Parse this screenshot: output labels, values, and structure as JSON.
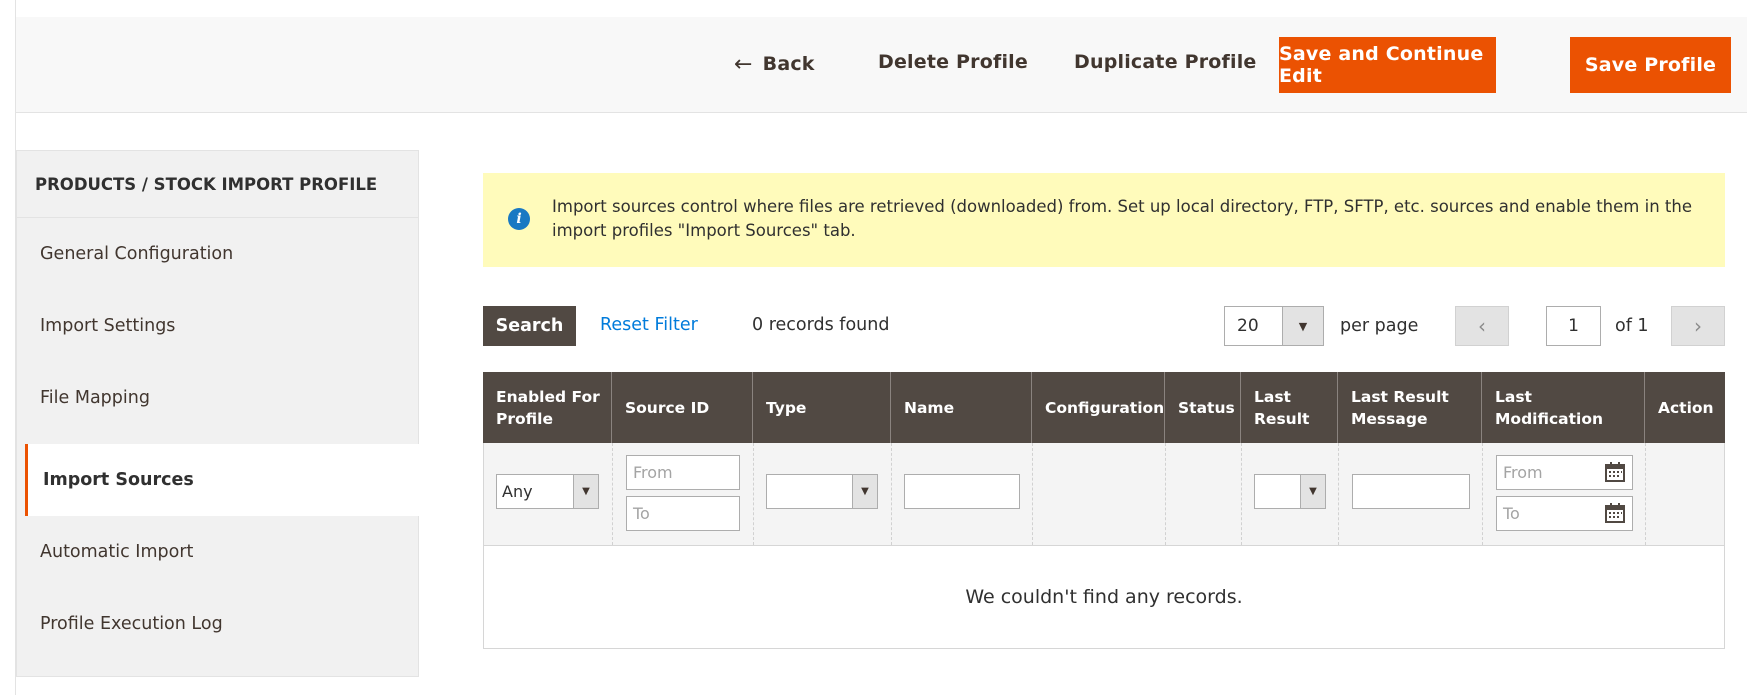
{
  "toolbar": {
    "back_label": "Back",
    "delete_label": "Delete Profile",
    "duplicate_label": "Duplicate Profile",
    "save_continue_label": "Save and Continue Edit",
    "save_label": "Save Profile"
  },
  "sidebar": {
    "title": "PRODUCTS / STOCK IMPORT PROFILE",
    "items": [
      {
        "label": "General Configuration",
        "active": false
      },
      {
        "label": "Import Settings",
        "active": false
      },
      {
        "label": "File Mapping",
        "active": false
      },
      {
        "label": "Import Sources",
        "active": true
      },
      {
        "label": "Automatic Import",
        "active": false
      },
      {
        "label": "Profile Execution Log",
        "active": false
      }
    ]
  },
  "notice": {
    "icon": "info-icon",
    "text": "Import sources control where files are retrieved (downloaded) from. Set up local directory, FTP, SFTP, etc. sources and enable them in the import profiles \"Import Sources\" tab."
  },
  "grid_controls": {
    "search_label": "Search",
    "reset_label": "Reset Filter",
    "records_text": "0 records found",
    "per_page_value": "20",
    "per_page_label": "per page",
    "current_page": "1",
    "of_label": "of 1"
  },
  "grid": {
    "columns": [
      "Enabled For Profile",
      "Source ID",
      "Type",
      "Name",
      "Configuration",
      "Status",
      "Last Result",
      "Last Result Message",
      "Last Modification",
      "Action"
    ],
    "filters": {
      "enabled_value": "Any",
      "source_from_placeholder": "From",
      "source_to_placeholder": "To",
      "type_value": "",
      "name_value": "",
      "last_result_value": "",
      "message_value": "",
      "mod_from_placeholder": "From",
      "mod_to_placeholder": "To"
    },
    "empty_message": "We couldn't find any records."
  },
  "colors": {
    "accent": "#eb5202",
    "header_bg": "#514943",
    "notice_bg": "#fffbbb",
    "link": "#007bdb"
  }
}
